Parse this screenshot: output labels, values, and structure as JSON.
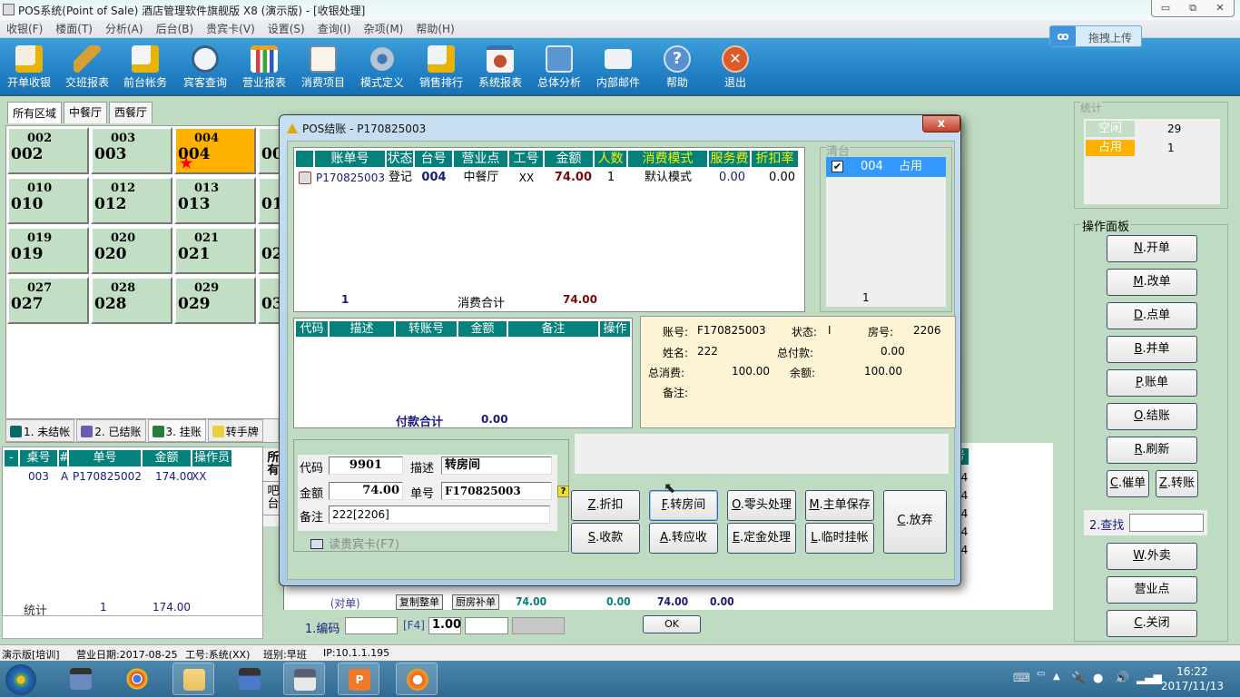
{
  "window": {
    "title": "POS系统(Point of Sale) 酒店管理软件旗舰版 X8 (演示版) - [收银处理]",
    "controls": [
      "minimize",
      "restore",
      "close"
    ]
  },
  "menu": [
    "收银(F)",
    "楼面(T)",
    "分析(A)",
    "后台(B)",
    "贵宾卡(V)",
    "设置(S)",
    "查询(I)",
    "杂项(M)",
    "帮助(H)"
  ],
  "toolbar": [
    {
      "label": "开单收银",
      "icon": "checklist-yen-icon"
    },
    {
      "label": "交班报表",
      "icon": "keys-icon"
    },
    {
      "label": "前台帐务",
      "icon": "document-yen-icon"
    },
    {
      "label": "宾客查询",
      "icon": "search-guest-icon"
    },
    {
      "label": "营业报表",
      "icon": "bar-chart-icon"
    },
    {
      "label": "消费项目",
      "icon": "clipboard-icon"
    },
    {
      "label": "模式定义",
      "icon": "gear-icon"
    },
    {
      "label": "销售排行",
      "icon": "ranking-yen-icon"
    },
    {
      "label": "系统报表",
      "icon": "pie-chart-icon"
    },
    {
      "label": "总体分析",
      "icon": "wave-chart-icon"
    },
    {
      "label": "内部邮件",
      "icon": "mail-icon"
    },
    {
      "label": "帮助",
      "icon": "help-icon"
    },
    {
      "label": "退出",
      "icon": "exit-icon"
    }
  ],
  "upload_button": "拖拽上传",
  "area_tabs": [
    "所有区域",
    "中餐厅",
    "西餐厅"
  ],
  "tables": [
    {
      "small": "002",
      "large": "002",
      "occupied": false
    },
    {
      "small": "003",
      "large": "003",
      "occupied": false
    },
    {
      "small": "004",
      "large": "004",
      "occupied": true
    },
    {
      "small": "010",
      "large": "010",
      "occupied": false
    },
    {
      "small": "012",
      "large": "012",
      "occupied": false
    },
    {
      "small": "013",
      "large": "013",
      "occupied": false
    },
    {
      "small": "019",
      "large": "019",
      "occupied": false
    },
    {
      "small": "020",
      "large": "020",
      "occupied": false
    },
    {
      "small": "021",
      "large": "021",
      "occupied": false
    },
    {
      "small": "027",
      "large": "027",
      "occupied": false
    },
    {
      "small": "028",
      "large": "028",
      "occupied": false
    },
    {
      "small": "029",
      "large": "029",
      "occupied": false
    }
  ],
  "table_partial": [
    "00",
    "01",
    "02",
    "03"
  ],
  "bill_tabs": [
    "1. 未结帐",
    "2. 已结账",
    "3. 挂账",
    "转手牌"
  ],
  "bill_grid": {
    "headers": [
      "-",
      "桌号",
      "#",
      "单号",
      "金额",
      "操作员"
    ],
    "rows": [
      [
        "",
        "003",
        "A",
        "P170825002",
        "174.00",
        "XX"
      ]
    ],
    "stat_label": "统计",
    "stat_count": "1",
    "stat_amount": "174.00"
  },
  "side_vtabs": [
    "所有",
    "吧台"
  ],
  "mid_bottom": {
    "label": "(对单)",
    "copy_btn": "复制整单",
    "kitchen_btn": "厨房补单",
    "v1": "74.00",
    "v2": "0.00",
    "v3": "74.00",
    "v4": "0.00"
  },
  "mid_partial_col": {
    "header": "号",
    "rows": [
      "04",
      "04",
      "04",
      "04",
      "04"
    ]
  },
  "code_bar": {
    "label": "1.编码",
    "f4": "[F4]",
    "qty": "1.00",
    "ok": "OK"
  },
  "stats": {
    "title": "统计",
    "idle_label": "空闲",
    "idle_count": "29",
    "busy_label": "占用",
    "busy_count": "1",
    "idle_color": "#c2dfc5",
    "busy_color": "#ffb100"
  },
  "op_panel": {
    "title": "操作面板",
    "buttons": [
      {
        "key": "N",
        "label": ".开单"
      },
      {
        "key": "M",
        "label": ".改单"
      },
      {
        "key": "D",
        "label": ".点单"
      },
      {
        "key": "B",
        "label": ".并单"
      },
      {
        "key": "P",
        "label": ".账单"
      },
      {
        "key": "O",
        "label": ".结账"
      },
      {
        "key": "R",
        "label": ".刷新"
      }
    ],
    "urge": {
      "key": "C",
      "label": ".催单"
    },
    "transfer": {
      "key": "Z",
      "label": ".转账"
    },
    "find_label": "2.查找",
    "takeout": {
      "key": "W",
      "label": ".外卖"
    },
    "outlet": "营业点",
    "close": {
      "key": "C",
      "label": ".关闭"
    }
  },
  "status_bar": {
    "mode": "演示版[培训]",
    "date": "营业日期:2017-08-25",
    "staff": "工号:系统(XX)",
    "shift": "班别:早班",
    "ip": "IP:10.1.1.195"
  },
  "taskbar": {
    "apps": [
      "start-orb",
      "video-editor",
      "chrome",
      "file-explorer",
      "movie-maker",
      "pos-cashier",
      "wps-presentation",
      "burner"
    ],
    "time": "16:22",
    "date": "2017/11/13"
  },
  "dialog": {
    "title": "POS结账 - P170825003",
    "consumption": {
      "headers": [
        "",
        "账单号",
        "状态",
        "台号",
        "营业点",
        "工号",
        "金额",
        "人数",
        "消费模式",
        "服务费",
        "折扣率"
      ],
      "rows": [
        [
          "",
          "P170825003",
          "登记",
          "004",
          "中餐厅",
          "XX",
          "74.00",
          "1",
          "默认模式",
          "0.00",
          "0.00"
        ]
      ],
      "footer_count": "1",
      "footer_label": "消费合计",
      "footer_total": "74.00"
    },
    "clear_table": {
      "title": "清台",
      "items": [
        {
          "checked": true,
          "table": "004",
          "status": "占用"
        }
      ],
      "count": "1"
    },
    "payments": {
      "headers": [
        "代码",
        "描述",
        "转账号",
        "金额",
        "备注",
        "操作"
      ],
      "footer_label": "付款合计",
      "footer_total": "0.00"
    },
    "account": {
      "acct_label": "账号:",
      "acct": "F170825003",
      "status_label": "状态:",
      "status": "I",
      "room_label": "房号:",
      "room": "2206",
      "name_label": "姓名:",
      "name": "222",
      "paid_label": "总付款:",
      "paid": "0.00",
      "spend_label": "总消费:",
      "spend": "100.00",
      "balance_label": "余额:",
      "balance": "100.00",
      "note_label": "备注:"
    },
    "entry": {
      "code_label": "代码",
      "code": "9901",
      "desc_label": "描述",
      "desc": "转房间",
      "amount_label": "金额",
      "amount": "74.00",
      "bill_label": "单号",
      "bill": "F170825003",
      "note_label": "备注",
      "note": "222[2206]",
      "vip_card": "读贵宾卡(F7)"
    },
    "buttons": [
      {
        "key": "Z",
        "label": ".折扣"
      },
      {
        "key": "F",
        "label": ".转房间"
      },
      {
        "key": "O",
        "label": ".零头处理"
      },
      {
        "key": "M",
        "label": ".主单保存"
      },
      {
        "key": "S",
        "label": ".收款"
      },
      {
        "key": "A",
        "label": ".转应收"
      },
      {
        "key": "E",
        "label": ".定金处理"
      },
      {
        "key": "L",
        "label": ".临时挂帐"
      }
    ],
    "abandon": {
      "key": "C",
      "label": ".放弃"
    }
  }
}
